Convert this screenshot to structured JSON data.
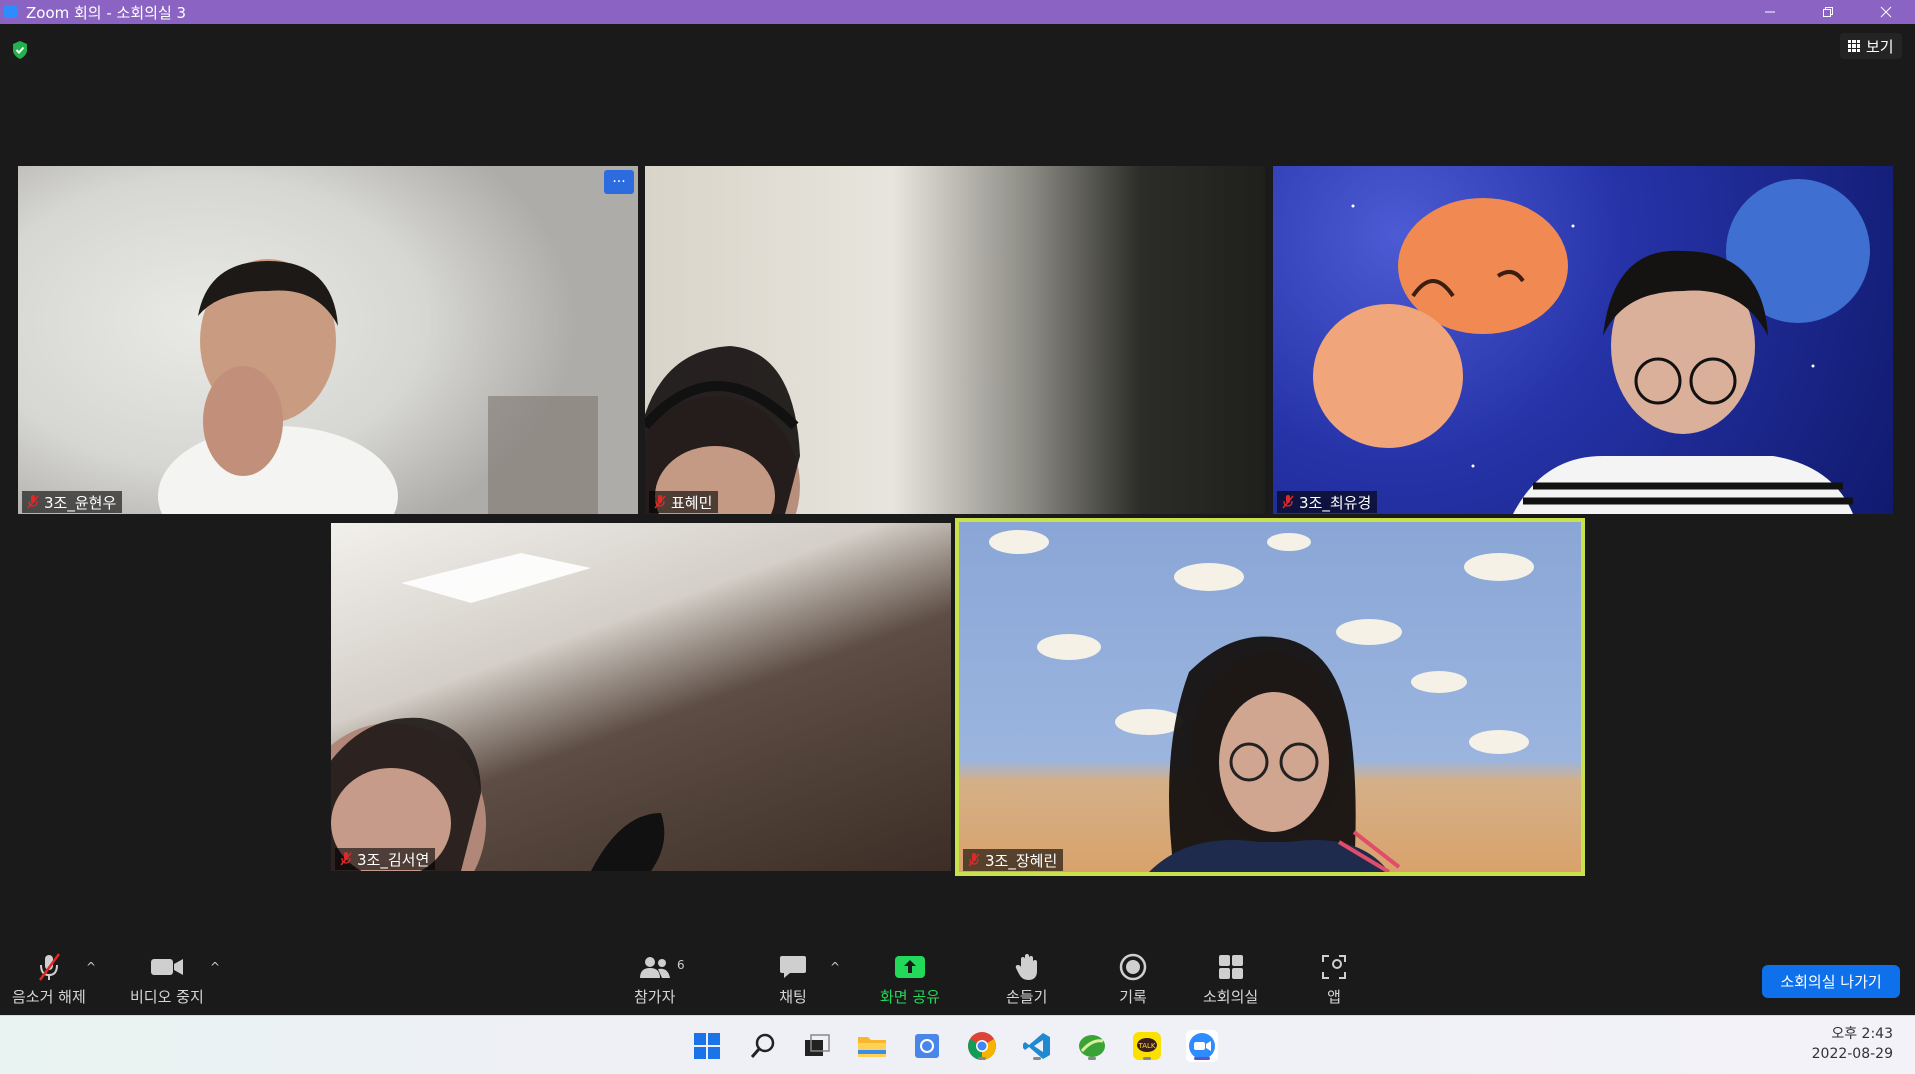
{
  "window": {
    "title": "Zoom 회의 - 소회의실 3",
    "controls": [
      "minimize",
      "restore",
      "close"
    ]
  },
  "meeting": {
    "security_icon": "shield-check-icon",
    "view_label": "보기"
  },
  "participants": [
    {
      "name": "3조_윤현우",
      "muted": true,
      "active": false
    },
    {
      "name": "표혜민",
      "muted": true,
      "active": false
    },
    {
      "name": "3조_최유경",
      "muted": true,
      "active": false
    },
    {
      "name": "3조_김서연",
      "muted": true,
      "active": false
    },
    {
      "name": "3조_장혜린",
      "muted": true,
      "active": true
    }
  ],
  "tile_more_label": "···",
  "toolbar": {
    "unmute": "음소거 해제",
    "stop_video": "비디오 중지",
    "participants": "참가자",
    "participants_count": "6",
    "chat": "채팅",
    "share_screen": "화면 공유",
    "raise_hand": "손들기",
    "record": "기록",
    "breakout_rooms": "소회의실",
    "apps": "앱",
    "leave_breakout": "소회의실 나가기"
  },
  "taskbar": {
    "apps": [
      "windows-start-icon",
      "search-icon",
      "task-view-icon",
      "file-explorer-icon",
      "settings-app-icon",
      "chrome-icon",
      "vscode-icon",
      "green-app-icon",
      "kakaotalk-icon",
      "zoom-icon"
    ],
    "kakaotalk_label": "TALK",
    "time": "오후 2:43",
    "date": "2022-08-29"
  },
  "colors": {
    "titlebar": "#8a63c3",
    "active_speaker_border": "#c9e24b",
    "share_green": "#23d959",
    "leave_blue": "#0e71eb",
    "mute_red": "#e02828"
  }
}
